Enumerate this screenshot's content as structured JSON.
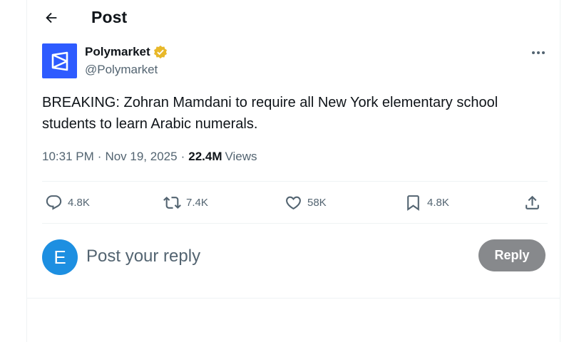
{
  "header": {
    "title": "Post"
  },
  "author": {
    "name": "Polymarket",
    "handle": "@Polymarket",
    "verified_color": "#e8b829",
    "avatar_color": "#2e5bff"
  },
  "post": {
    "text": "BREAKING: Zohran Mamdani to require all New York elementary school students to learn Arabic numerals.",
    "time": "10:31 PM",
    "date": "Nov 19, 2025",
    "separator": "·",
    "views_count": "22.4M",
    "views_label": "Views"
  },
  "actions": {
    "replies": "4.8K",
    "reposts": "7.4K",
    "likes": "58K",
    "bookmarks": "4.8K"
  },
  "compose": {
    "avatar_letter": "E",
    "placeholder": "Post your reply",
    "button_label": "Reply"
  },
  "icons": [
    "back-arrow-icon",
    "verified-badge-icon",
    "more-icon",
    "reply-icon",
    "repost-icon",
    "like-icon",
    "bookmark-icon",
    "share-icon"
  ]
}
